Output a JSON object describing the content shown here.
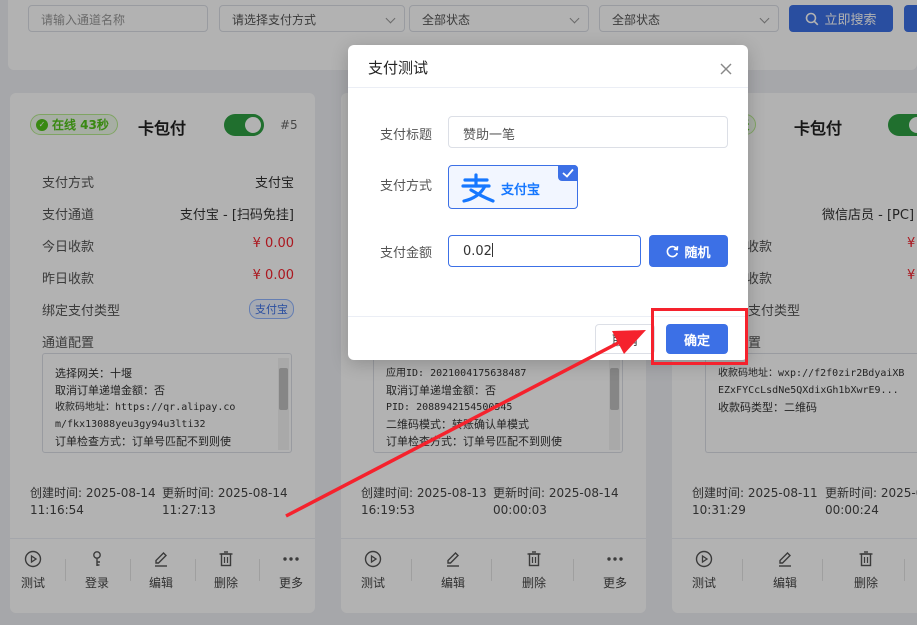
{
  "filters": {
    "channel_name_placeholder": "请输入通道名称",
    "pay_method_placeholder": "请选择支付方式",
    "status_1": "全部状态",
    "status_2": "全部状态",
    "search_label": "立即搜索"
  },
  "cards": [
    {
      "online_label": "在线 43秒",
      "name": "卡包付",
      "id": "#5",
      "enabled": true,
      "rows": [
        {
          "label": "支付方式",
          "value": "支付宝"
        },
        {
          "label": "支付通道",
          "value": "支付宝 - [扫码免挂]"
        },
        {
          "label": "今日收款",
          "value": "¥ 0.00"
        },
        {
          "label": "昨日收款",
          "value": "¥ 0.00"
        }
      ],
      "bind_type_label": "绑定支付类型",
      "bind_type_tag": "支付宝",
      "config_label": "通道配置",
      "config_lines": [
        "选择网关：十堰",
        "取消订单递增金额：否",
        "收款码地址：https://qr.alipay.co",
        "m/fkx13088yeu3gy94u3lti32",
        "订单检查方式：订单号匹配不到则使"
      ],
      "created": "创建时间: 2025-08-14",
      "created_time": "11:16:54",
      "updated": "更新时间: 2025-08-14",
      "updated_time": "11:27:13",
      "actions": [
        "测试",
        "登录",
        "编辑",
        "删除",
        "更多"
      ]
    },
    {
      "config_lines": [
        "应用ID: 2021004175638487",
        "取消订单递增金额：否",
        "PID: 2088942154500545",
        "二维码模式：转账确认单模式",
        "订单检查方式：订单号匹配不到则使"
      ],
      "created": "创建时间: 2025-08-13",
      "created_time": "16:19:53",
      "updated": "更新时间: 2025-08-14",
      "updated_time": "00:00:03",
      "actions": [
        "测试",
        "编辑",
        "删除",
        "更多"
      ]
    },
    {
      "online_label": "3天",
      "name": "卡包付",
      "rows": [
        {
          "label": "",
          "value": ""
        },
        {
          "label": "",
          "value": "微信店员 - [PC]"
        },
        {
          "label": "收款",
          "value": "¥"
        },
        {
          "label": "收款",
          "value": "¥"
        }
      ],
      "bind_type_label": "支付类型",
      "config_label": "置",
      "config_lines": [
        "收款码地址：wxp://f2f0zir2BdyaiXB",
        "EZxFYCcLsdNe5QXdixGh1bXwrE9...",
        "收款码类型：二维码"
      ],
      "created": "创建时间: 2025-08-11",
      "created_time": "10:31:29",
      "updated": "更新时间: 2025-08-14",
      "updated_time": "00:00:24",
      "actions": [
        "测试",
        "编辑",
        "删除"
      ]
    }
  ],
  "dialog": {
    "title": "支付测试",
    "subject_label": "支付标题",
    "subject_value": "赞助一笔",
    "method_label": "支付方式",
    "method_value": "支付宝",
    "amount_label": "支付金额",
    "amount_value": "0.02",
    "random_label": "随机",
    "cancel_label": "取消",
    "confirm_label": "确定"
  },
  "colors": {
    "primary": "#3c70e6",
    "online_green": "#52c41a",
    "amount_red": "#f5222d",
    "annotation_red": "#f5222d"
  }
}
